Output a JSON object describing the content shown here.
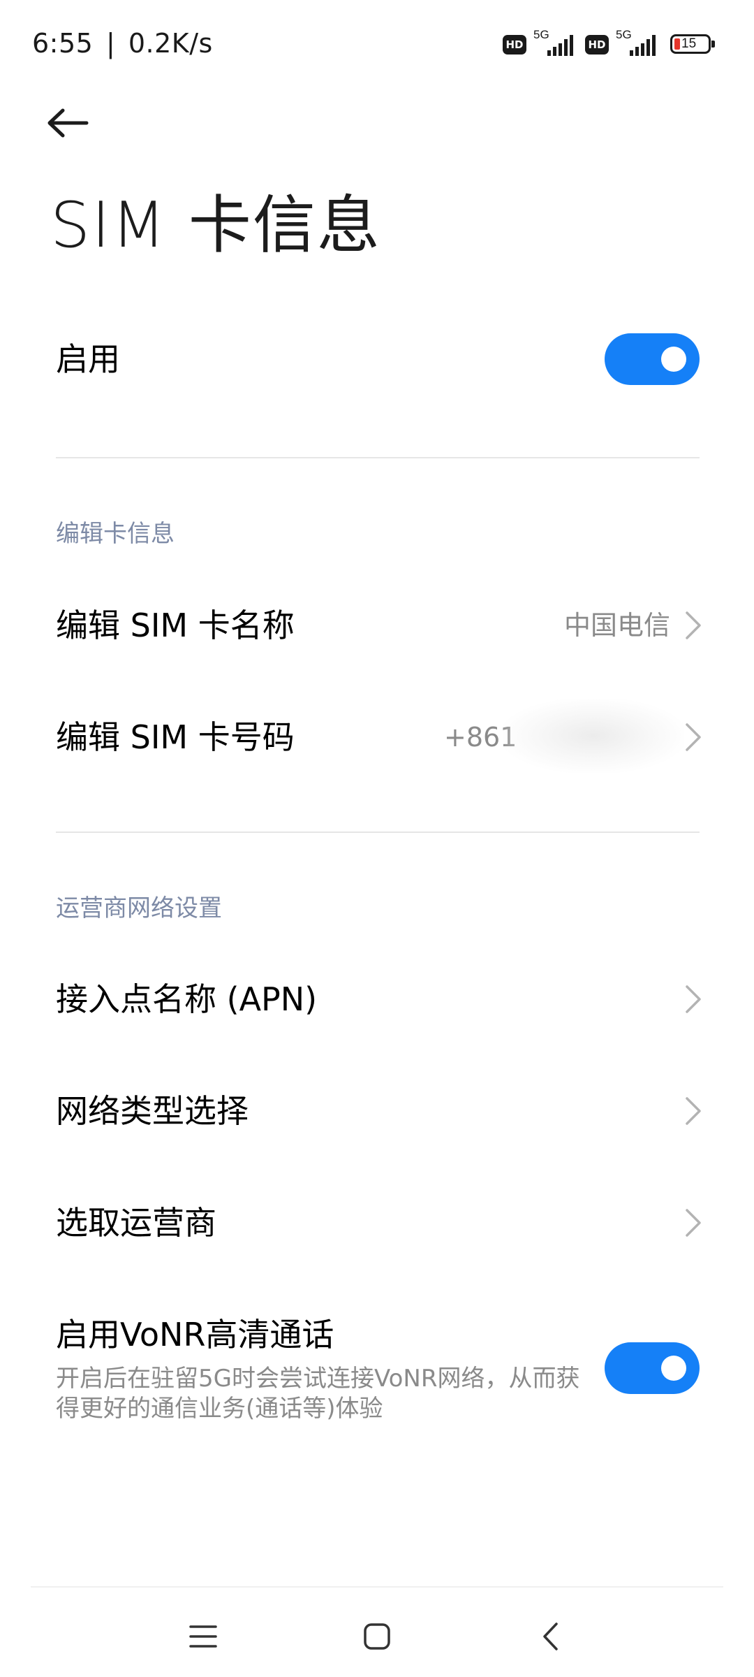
{
  "status_bar": {
    "time": "6:55",
    "separator": "|",
    "speed": "0.2K/s",
    "sim1": {
      "badge": "HD",
      "network": "5G"
    },
    "sim2": {
      "badge": "HD",
      "network": "5G"
    },
    "battery_level": "15"
  },
  "header": {
    "back_icon": "arrow-left-icon",
    "title": "SIM 卡信息"
  },
  "enable": {
    "label": "启用",
    "toggle_on": true
  },
  "section_edit": {
    "header": "编辑卡信息",
    "name_row": {
      "label": "编辑 SIM 卡名称",
      "value": "中国电信"
    },
    "number_row": {
      "label": "编辑 SIM 卡号码",
      "value": "+861"
    }
  },
  "section_carrier": {
    "header": "运营商网络设置",
    "apn_row": {
      "label": "接入点名称 (APN)"
    },
    "network_type_row": {
      "label": "网络类型选择"
    },
    "operator_row": {
      "label": "选取运营商"
    },
    "vonr_row": {
      "label": "启用VoNR高清通话",
      "description": "开启后在驻留5G时会尝试连接VoNR网络，从而获得更好的通信业务(通话等)体验",
      "toggle_on": true
    }
  },
  "nav_bar": {
    "menu_icon": "menu-icon",
    "home_icon": "home-icon",
    "back_icon": "chevron-left-icon"
  },
  "colors": {
    "accent": "#1580f7",
    "section_header": "#7d8aa6",
    "secondary_text": "#8a8a8a",
    "battery_low": "#e5352b"
  }
}
